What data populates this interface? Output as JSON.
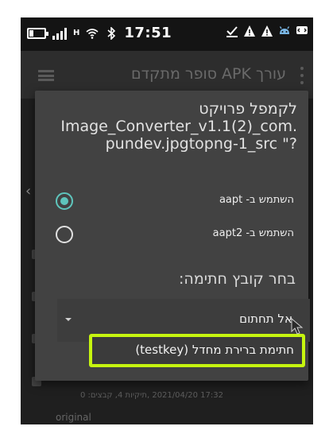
{
  "status_bar": {
    "time": "17:51",
    "network_label": "H",
    "icons": [
      "battery-icon",
      "signal-icon",
      "wifi-icon",
      "bluetooth-icon",
      "download-check-icon",
      "warning-icon",
      "warning-icon",
      "android-icon",
      "message-icon"
    ]
  },
  "app_bar": {
    "title": "עורך APK סופר מתקדם",
    "menu_icon": "hamburger-menu-icon",
    "overflow_icon": "kebab-menu-icon"
  },
  "background": {
    "meta_text": "17:32 2021/04/20 ,תיקיות 4, קבצים: 0",
    "original_label": "original"
  },
  "dialog": {
    "title_lines": [
      "לקמפל פרויקט",
      "Image_Converter_v1.1(2)_com.",
      "pundev.jpgtopng-1_src \"?"
    ],
    "options": [
      {
        "label": "השתמש ב- aapt",
        "checked": true
      },
      {
        "label": "השתמש ב- aapt2",
        "checked": false
      }
    ],
    "signing_label": "בחר קובץ חתימה:",
    "select_value": "אל תחתום",
    "dropdown_item": "חתימת ברירת מחדל (testkey)",
    "accent_color": "#5ec5bc",
    "highlight_color": "#c6f50f"
  }
}
